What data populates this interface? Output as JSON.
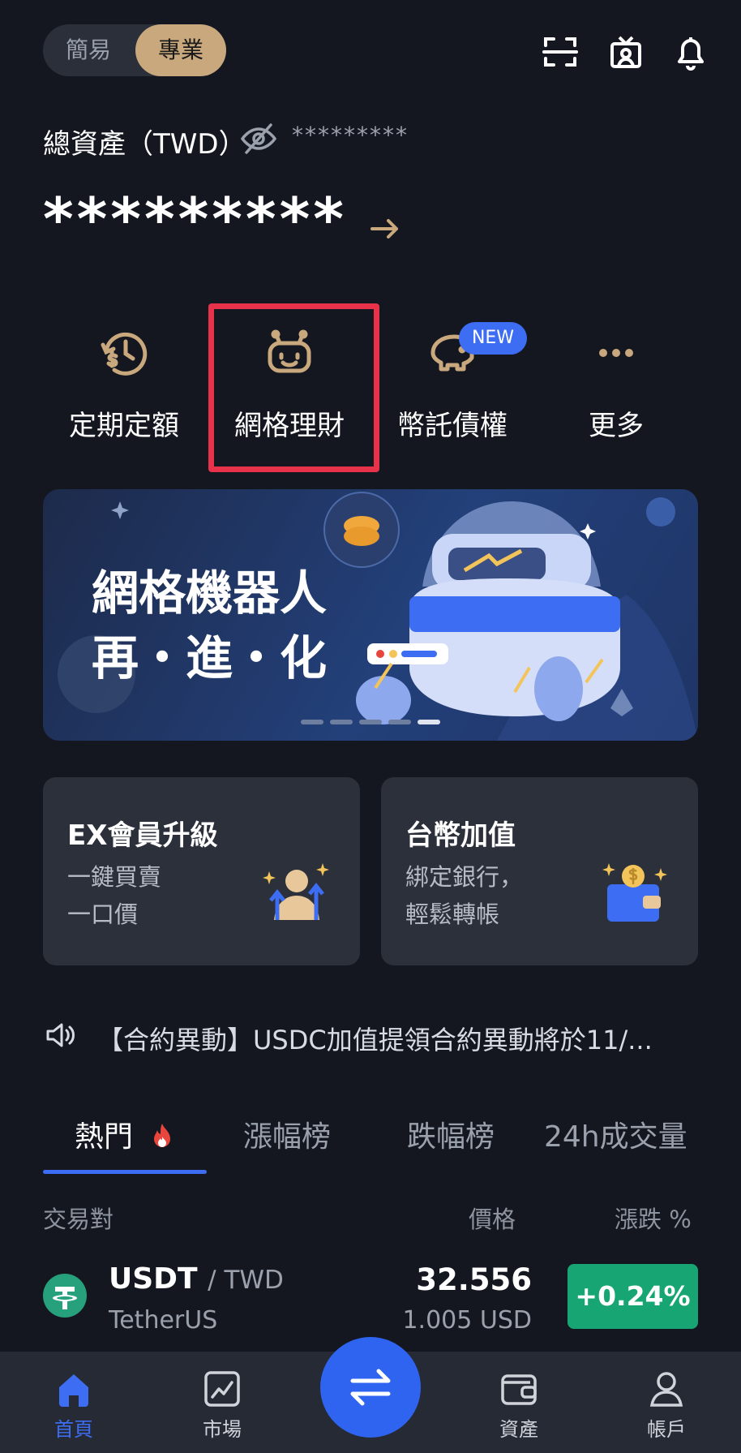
{
  "header": {
    "mode_simple": "簡易",
    "mode_pro": "專業"
  },
  "balance": {
    "label": "總資產（TWD）",
    "sub_value": "*********",
    "main_value": "*********"
  },
  "quick_actions": [
    {
      "label": "定期定額",
      "icon": "recurring-clock-icon"
    },
    {
      "label": "網格理財",
      "icon": "grid-bot-icon"
    },
    {
      "label": "幣託債權",
      "icon": "piggy-bank-icon",
      "badge": "NEW"
    },
    {
      "label": "更多",
      "icon": "more-dots-icon"
    }
  ],
  "banner": {
    "line1": "網格機器人",
    "line2": "再・進・化"
  },
  "cards": [
    {
      "title": "EX會員升級",
      "desc1": "一鍵買賣",
      "desc2": "一口價"
    },
    {
      "title": "台幣加值",
      "desc1": "綁定銀行，",
      "desc2": "輕鬆轉帳"
    }
  ],
  "announcement": {
    "text": "【合約異動】USDC加值提領合約異動將於11/..."
  },
  "tabs": [
    {
      "label": "熱門"
    },
    {
      "label": "漲幅榜"
    },
    {
      "label": "跌幅榜"
    },
    {
      "label": "24h成交量"
    }
  ],
  "table": {
    "headers": {
      "pair": "交易對",
      "price": "價格",
      "change": "漲跌 %"
    },
    "rows": [
      {
        "symbol": "USDT",
        "quote": "/ TWD",
        "name": "TetherUS",
        "price": "32.556",
        "price_usd": "1.005 USD",
        "change": "+0.24%"
      }
    ]
  },
  "bottom_nav": [
    {
      "label": "首頁"
    },
    {
      "label": "市場"
    },
    {
      "label": "資產"
    },
    {
      "label": "帳戶"
    }
  ],
  "colors": {
    "background": "#141720",
    "accent_gold": "#c8a87c",
    "accent_blue": "#3d6df2",
    "highlight_red": "#e8324a",
    "positive_green": "#17a673"
  }
}
